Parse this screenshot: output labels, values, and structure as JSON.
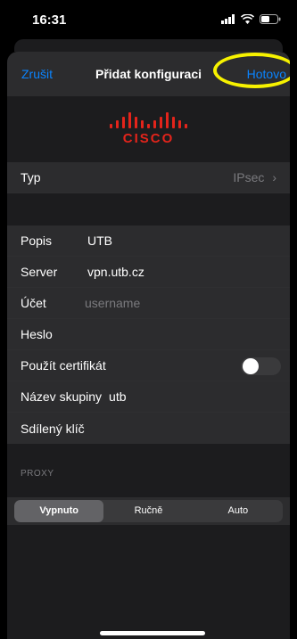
{
  "status_bar": {
    "time": "16:31"
  },
  "nav": {
    "cancel": "Zrušit",
    "title": "Přidat konfiguraci",
    "done": "Hotovo"
  },
  "logo": {
    "text": "cisco",
    "bar_heights": [
      5,
      9,
      13,
      18,
      13,
      9,
      5,
      9,
      13,
      18,
      13,
      9,
      5
    ]
  },
  "type_row": {
    "label": "Typ",
    "value": "IPsec",
    "chevron": "›"
  },
  "fields": {
    "popis": {
      "label": "Popis",
      "value": "UTB"
    },
    "server": {
      "label": "Server",
      "value": "vpn.utb.cz"
    },
    "ucet": {
      "label": "Účet",
      "placeholder": "username"
    },
    "heslo": {
      "label": "Heslo"
    },
    "certifikat": {
      "label": "Použít certifikát",
      "enabled": false
    },
    "skupina": {
      "label": "Název skupiny",
      "value": "utb"
    },
    "klic": {
      "label": "Sdílený klíč"
    }
  },
  "proxy": {
    "label": "PROXY",
    "options": [
      "Vypnuto",
      "Ručně",
      "Auto"
    ],
    "selected": "Vypnuto"
  },
  "colors": {
    "accent": "#0a84ff",
    "highlight": "#f7f200",
    "logo": "#e3241b"
  }
}
